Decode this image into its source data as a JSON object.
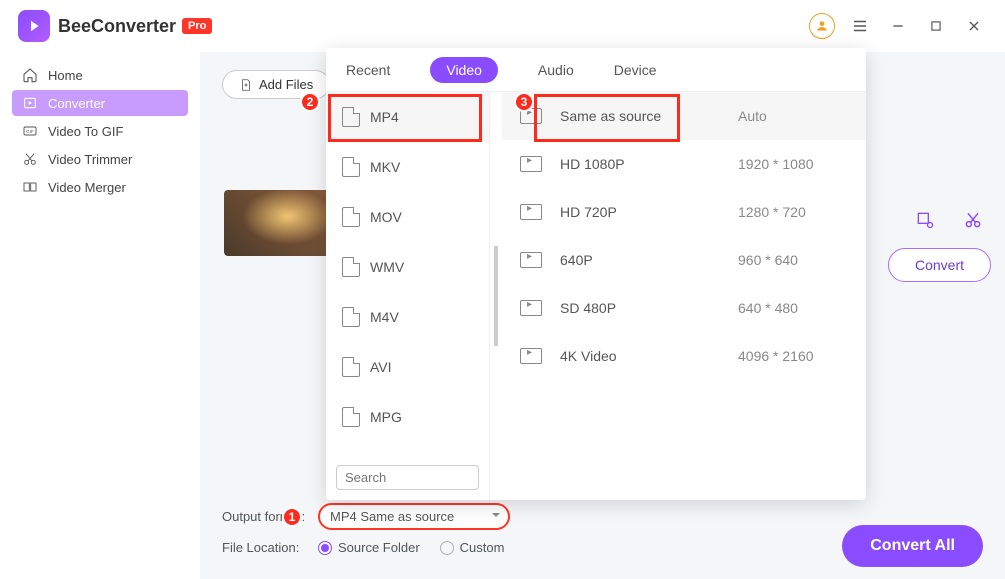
{
  "app": {
    "name": "BeeConverter",
    "edition": "Pro"
  },
  "sidebar": {
    "items": [
      {
        "label": "Home"
      },
      {
        "label": "Converter"
      },
      {
        "label": "Video To GIF"
      },
      {
        "label": "Video Trimmer"
      },
      {
        "label": "Video Merger"
      }
    ]
  },
  "toolbar": {
    "add_files": "Add Files"
  },
  "actions": {
    "convert": "Convert",
    "convert_all": "Convert All"
  },
  "bottom": {
    "output_label": "Output format:",
    "output_value": "MP4 Same as source",
    "location_label": "File Location:",
    "loc_source": "Source Folder",
    "loc_custom": "Custom"
  },
  "panel": {
    "tabs": [
      "Recent",
      "Video",
      "Audio",
      "Device"
    ],
    "active_tab": 1,
    "formats": [
      "MP4",
      "MKV",
      "MOV",
      "WMV",
      "M4V",
      "AVI",
      "MPG"
    ],
    "active_format": 0,
    "search_placeholder": "Search",
    "sizes": [
      {
        "name": "Same as source",
        "res": "Auto"
      },
      {
        "name": "HD 1080P",
        "res": "1920 * 1080"
      },
      {
        "name": "HD 720P",
        "res": "1280 * 720"
      },
      {
        "name": "640P",
        "res": "960 * 640"
      },
      {
        "name": "SD 480P",
        "res": "640 * 480"
      },
      {
        "name": "4K Video",
        "res": "4096 * 2160"
      }
    ],
    "active_size": 0
  },
  "annotations": {
    "a1": "1",
    "a2": "2",
    "a3": "3"
  }
}
